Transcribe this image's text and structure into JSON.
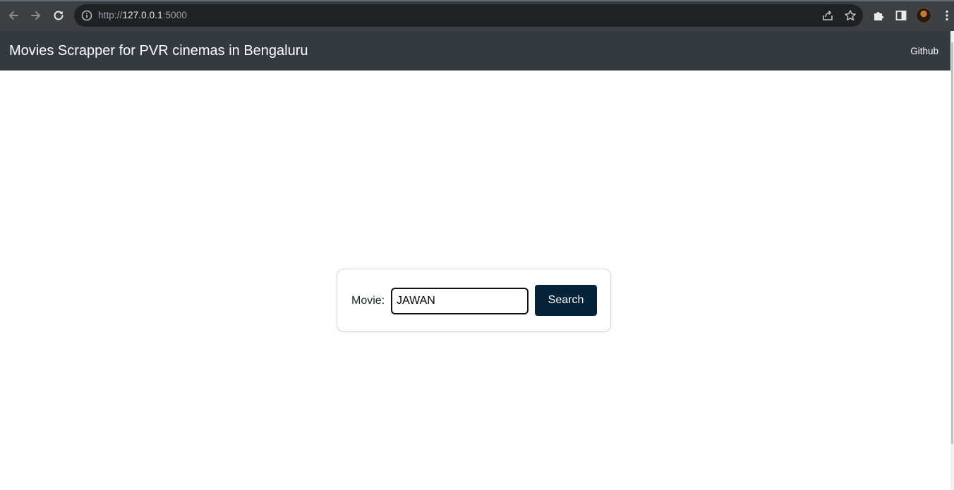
{
  "browser": {
    "url_scheme": "http://",
    "url_host": "127.0.0.1",
    "url_port": ":5000",
    "icons": [
      "back-icon",
      "forward-icon",
      "reload-icon",
      "info-icon",
      "share-icon",
      "star-icon",
      "extensions-icon",
      "side-panel-icon",
      "avatar",
      "kebab-menu-icon"
    ]
  },
  "navbar": {
    "brand": "Movies Scrapper for PVR cinemas in Bengaluru",
    "github_link": "Github",
    "background": "#343a40"
  },
  "search": {
    "label": "Movie:",
    "input_value": "JAWAN",
    "button_label": "Search",
    "button_color": "#06233a"
  }
}
